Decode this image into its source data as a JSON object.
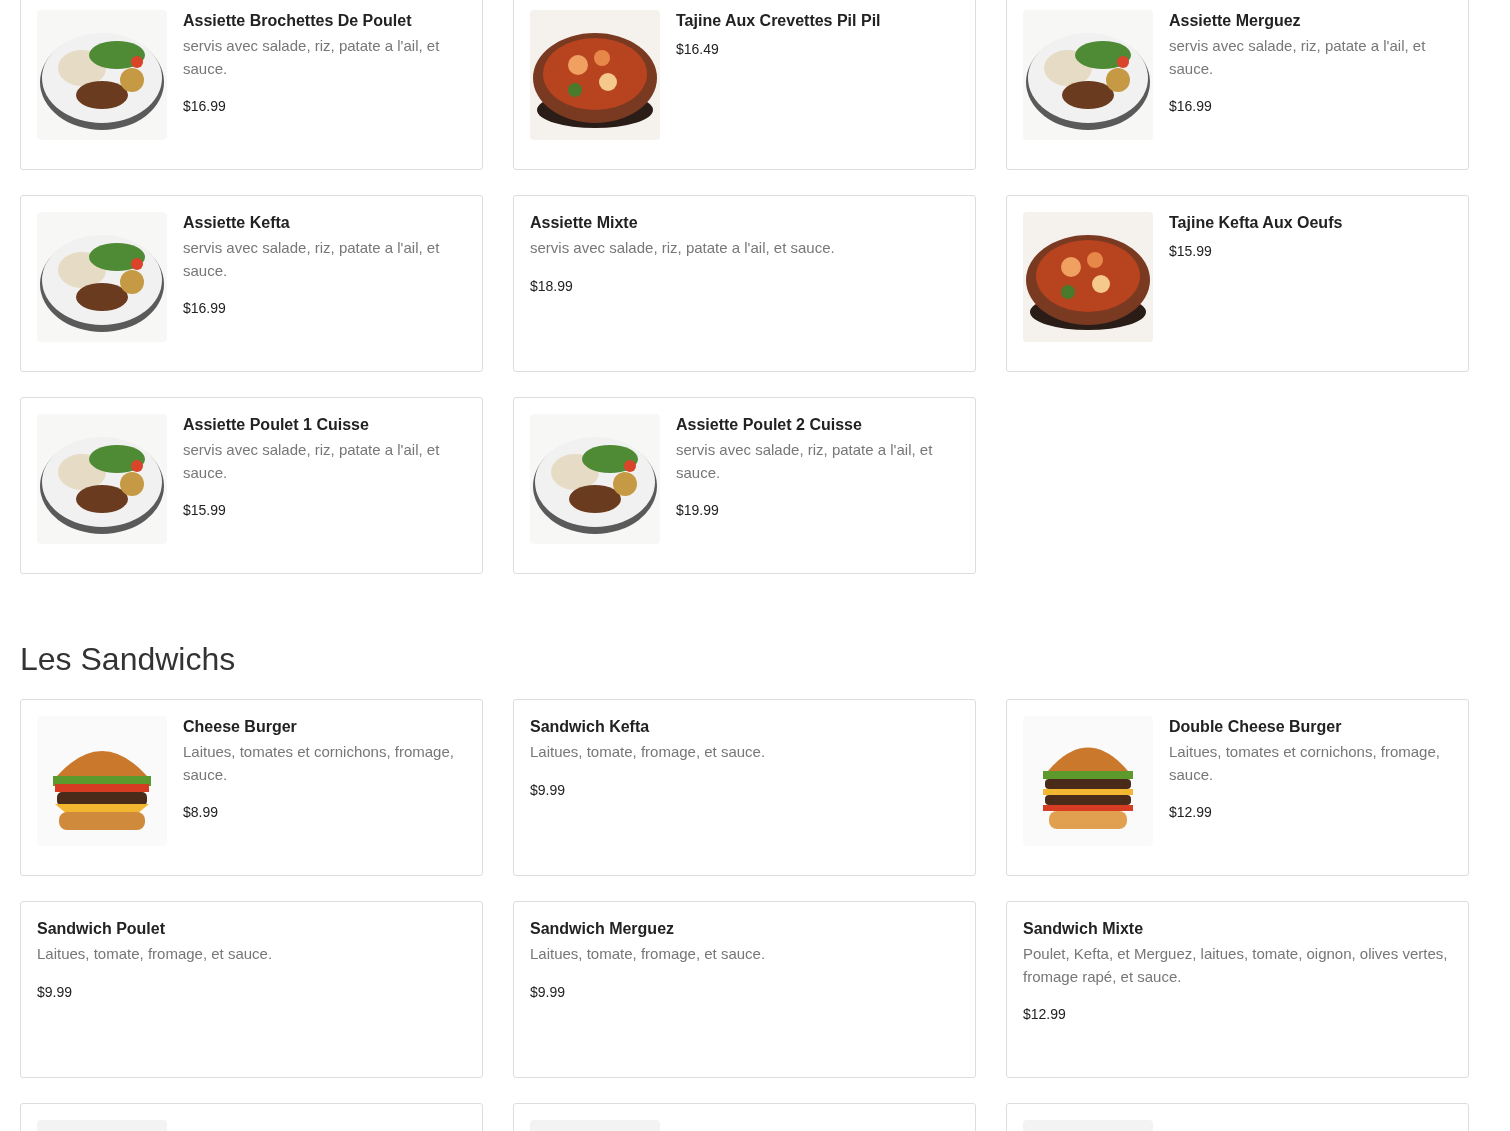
{
  "sections": [
    {
      "items": [
        {
          "name": "Assiette Brochettes De Poulet",
          "description": "servis avec salade, riz, patate a l'ail, et sauce.",
          "price": "$16.99",
          "image": {
            "kind": "picture"
          }
        },
        {
          "name": "Tajine Aux Crevettes Pil Pil",
          "price": "$16.49",
          "image": {
            "kind": "picture"
          }
        },
        {
          "name": "Assiette Merguez",
          "description": "servis avec salade, riz, patate a l'ail, et sauce.",
          "price": "$16.99",
          "image": {
            "kind": "picture"
          }
        },
        {
          "name": "Assiette Kefta",
          "description": "servis avec salade, riz, patate a l'ail, et sauce.",
          "price": "$16.99",
          "image": {
            "kind": "picture"
          }
        },
        {
          "name": "Assiette Mixte",
          "description": "servis avec salade, riz, patate a l'ail, et sauce.",
          "price": "$18.99"
        },
        {
          "name": "Tajine Kefta Aux Oeufs",
          "price": "$15.99",
          "image": {
            "kind": "picture"
          }
        },
        {
          "name": "Assiette Poulet 1 Cuisse",
          "description": "servis avec salade, riz, patate a l'ail, et sauce.",
          "price": "$15.99",
          "image": {
            "kind": "picture"
          }
        },
        {
          "name": "Assiette Poulet 2 Cuisse",
          "description": "servis avec salade, riz, patate a l'ail, et sauce.",
          "price": "$19.99",
          "image": {
            "kind": "picture"
          }
        }
      ]
    },
    {
      "heading": "Les Sandwichs",
      "items": [
        {
          "name": "Cheese Burger",
          "description": "Laitues, tomates et cornichons, fromage, sauce.",
          "price": "$8.99",
          "image": {
            "kind": "picture"
          }
        },
        {
          "name": "Sandwich Kefta",
          "description": "Laitues, tomate, fromage, et sauce.",
          "price": "$9.99"
        },
        {
          "name": "Double Cheese Burger",
          "description": "Laitues, tomates et cornichons, fromage, sauce.",
          "price": "$12.99",
          "image": {
            "kind": "picture"
          }
        },
        {
          "name": "Sandwich Poulet",
          "description": "Laitues, tomate, fromage, et sauce.",
          "price": "$9.99"
        },
        {
          "name": "Sandwich Merguez",
          "description": "Laitues, tomate, fromage, et sauce.",
          "price": "$9.99"
        },
        {
          "name": "Sandwich Mixte",
          "description": "Poulet, Kefta, et Merguez, laitues, tomate, oignon, olives vertes, fromage rapé, et sauce.",
          "price": "$12.99"
        },
        {
          "image": {
            "kind": "picture"
          }
        },
        {
          "image": {
            "kind": "picture"
          }
        },
        {
          "image": {
            "kind": "picture"
          }
        }
      ]
    }
  ]
}
